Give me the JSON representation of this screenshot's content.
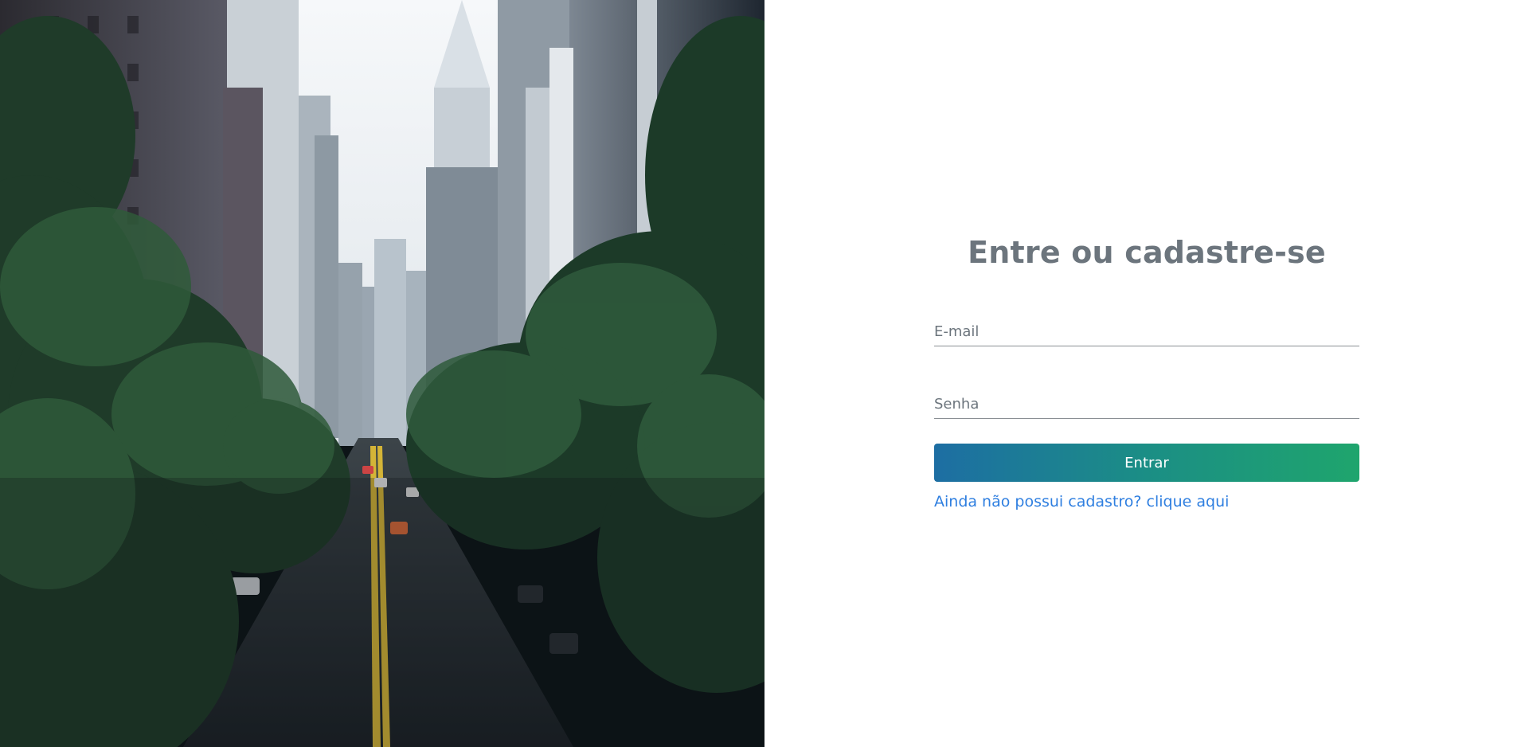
{
  "hero": {
    "image": "city-street-skyscrapers-photo"
  },
  "login": {
    "title": "Entre ou cadastre-se",
    "email_placeholder": "E-mail",
    "password_placeholder": "Senha",
    "submit_label": "Entrar",
    "signup_link": "Ainda não possui cadastro? clique aqui"
  },
  "colors": {
    "title": "#6c757d",
    "button_gradient_start": "#1d6ea3",
    "button_gradient_end": "#1fa56d",
    "link": "#2f7fe0"
  }
}
